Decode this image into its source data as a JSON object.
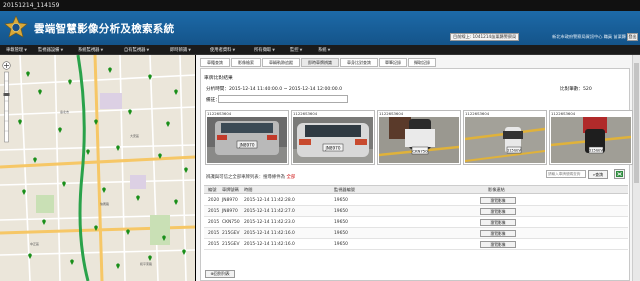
{
  "window": {
    "title": "20151214_114159"
  },
  "app": {
    "title": "雲端智慧影像分析及檢索系統",
    "online_text": "目前線上: 1041214苗栗縣警察局",
    "user_text": "新北市政府警察局資訊中心 職員 苗栗縣",
    "logout_label": "登出"
  },
  "nav": [
    "車載管理",
    "監視器設備",
    "系統監視器",
    "自有監視器",
    "即時辨識",
    "使用者資料",
    "所有擷取",
    "監控",
    "系統"
  ],
  "tabs": [
    "車籍查詢",
    "影像檢索",
    "車輛軌跡追蹤",
    "即時車牌辨識",
    "車身比對查詢",
    "單筆記錄",
    "擷取記錄"
  ],
  "active_tab_index": 3,
  "section": {
    "title": "車牌比對結果",
    "time_label": "分析時間：2015-12-14 11:40:00.0 ~ 2015-12-14 12:00:00.0",
    "result_label": "比對筆數：520",
    "note_label": "備註："
  },
  "thumbnails": [
    {
      "caption": "11226S3604",
      "plate": "JN8970"
    },
    {
      "caption": "11226S3604",
      "plate": "JN8970"
    },
    {
      "caption": "11226S3604",
      "plate": "CKN750"
    },
    {
      "caption": "11226S3604",
      "plate": "215GEV"
    },
    {
      "caption": "11226S3604",
      "plate": "215GEV"
    }
  ],
  "filter": {
    "prefix": "辨識與可信之全部車牌列表：搜尋條件為",
    "highlight": "全部",
    "search_placeholder": "請輸入車牌號碼查詢",
    "search_label": "查詢"
  },
  "table": {
    "columns": [
      "編號",
      "車牌號碼",
      "時間",
      "監視器編號",
      "影像連結"
    ],
    "rows": [
      {
        "id": "2020",
        "plate": "JN8970",
        "time": "2015-12-14 11:42:28.0",
        "camera": "19650",
        "action": "瀏覽影像"
      },
      {
        "id": "2015",
        "plate": "JN8970",
        "time": "2015-12-14 11:42:27.0",
        "camera": "19650",
        "action": "瀏覽影像"
      },
      {
        "id": "2015",
        "plate": "CKN750",
        "time": "2015-12-14 11:42:23.0",
        "camera": "19650",
        "action": "瀏覽影像"
      },
      {
        "id": "2015",
        "plate": "215GEV",
        "time": "2015-12-14 11:42:16.0",
        "camera": "19650",
        "action": "瀏覽影像"
      },
      {
        "id": "2015",
        "plate": "215GEV",
        "time": "2015-12-14 11:42:16.0",
        "camera": "19650",
        "action": "瀏覽影像"
      }
    ]
  },
  "back_label": "回到列表",
  "colors": {
    "header": "#1a5f99",
    "navbar": "#1b1b1b",
    "map_road": "#f6c766",
    "map_green": "#1a8f1a"
  }
}
